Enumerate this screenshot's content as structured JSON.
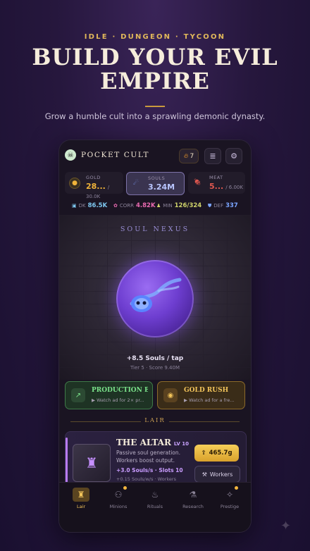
{
  "promo": {
    "tagline": "IDLE · DUNGEON · TYCOON",
    "headline_line1": "BUILD YOUR EVIL",
    "headline_line2": "EMPIRE",
    "subline": "Grow a humble cult into a sprawling demonic dynasty."
  },
  "app": {
    "title": "POCKET CULT",
    "fire_count": "7",
    "icons": {
      "logo": "skull-icon",
      "fire": "fire-icon",
      "scroll": "scroll-icon",
      "settings": "gear-icon"
    }
  },
  "resources": [
    {
      "label": "GOLD",
      "value": "28...",
      "cap": "/ 30.0K",
      "icon": "coin-icon",
      "color": "#f0b43a",
      "active": false
    },
    {
      "label": "SOULS",
      "value": "3.24M",
      "cap": "",
      "icon": "soul-icon",
      "color": "#9fb4ff",
      "active": true
    },
    {
      "label": "MEAT",
      "value": "5...",
      "cap": "/ 6.00K",
      "icon": "meat-icon",
      "color": "#e0574f",
      "active": false
    }
  ],
  "stats": [
    {
      "label": "DK",
      "value": "86.5K",
      "color": "#7ec8f0"
    },
    {
      "label": "CORR",
      "value": "4.82K",
      "color": "#e86ab0"
    },
    {
      "label": "MIN",
      "value": "126/324",
      "color": "#cfd36a"
    },
    {
      "label": "DEF",
      "value": "337",
      "color": "#7aa4ff"
    }
  ],
  "nexus": {
    "title": "SOUL NEXUS",
    "tap": "+8.5 Souls / tap",
    "tier": "Tier 5 · Score 9.40M"
  },
  "boosts": [
    {
      "title": "PRODUCTION B...",
      "sub": "Watch ad for 2× pr...",
      "color": "#7be38b"
    },
    {
      "title": "GOLD RUSH",
      "sub": "Watch ad for a fre...",
      "color": "#f3c55b"
    }
  ],
  "section": {
    "title": "LAIR"
  },
  "building": {
    "name": "THE ALTAR",
    "level": "LV 10",
    "desc": "Passive soul generation. Workers boost output.",
    "rate": "+3.0 Souls/s · Slots 10",
    "rate2": "+0.15 Souls/w/s · Workers",
    "buy": "465.7g",
    "workers": "Workers"
  },
  "nav": [
    {
      "label": "Lair",
      "icon": "castle-icon",
      "active": true,
      "dot": false
    },
    {
      "label": "Minions",
      "icon": "minions-icon",
      "active": false,
      "dot": true
    },
    {
      "label": "Rituals",
      "icon": "flame-icon",
      "active": false,
      "dot": false
    },
    {
      "label": "Research",
      "icon": "flask-icon",
      "active": false,
      "dot": false
    },
    {
      "label": "Prestige",
      "icon": "sparkle-icon",
      "active": false,
      "dot": true
    }
  ]
}
